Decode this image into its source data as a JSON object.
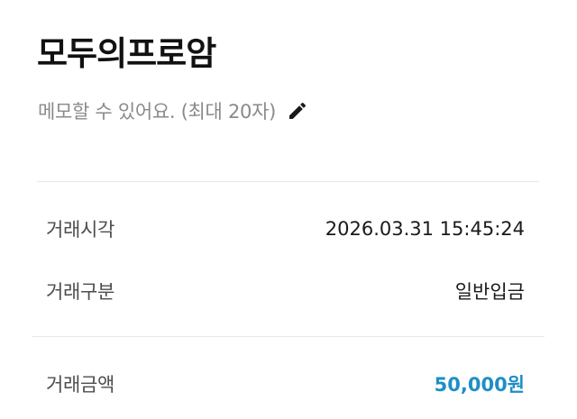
{
  "header": {
    "title": "모두의프로암",
    "memo_placeholder": "메모할 수 있어요. (최대 20자)",
    "edit_icon": "pencil-icon"
  },
  "details": [
    {
      "label": "거래시각",
      "value": "2026.03.31 15:45:24"
    },
    {
      "label": "거래구분",
      "value": "일반입금"
    },
    {
      "label": "거래금액",
      "value": "50,000원"
    }
  ],
  "colors": {
    "amount": "#1e8fc4",
    "label": "#4d4d4d",
    "memo": "#8a8a8a",
    "divider": "#e6e6e6"
  }
}
